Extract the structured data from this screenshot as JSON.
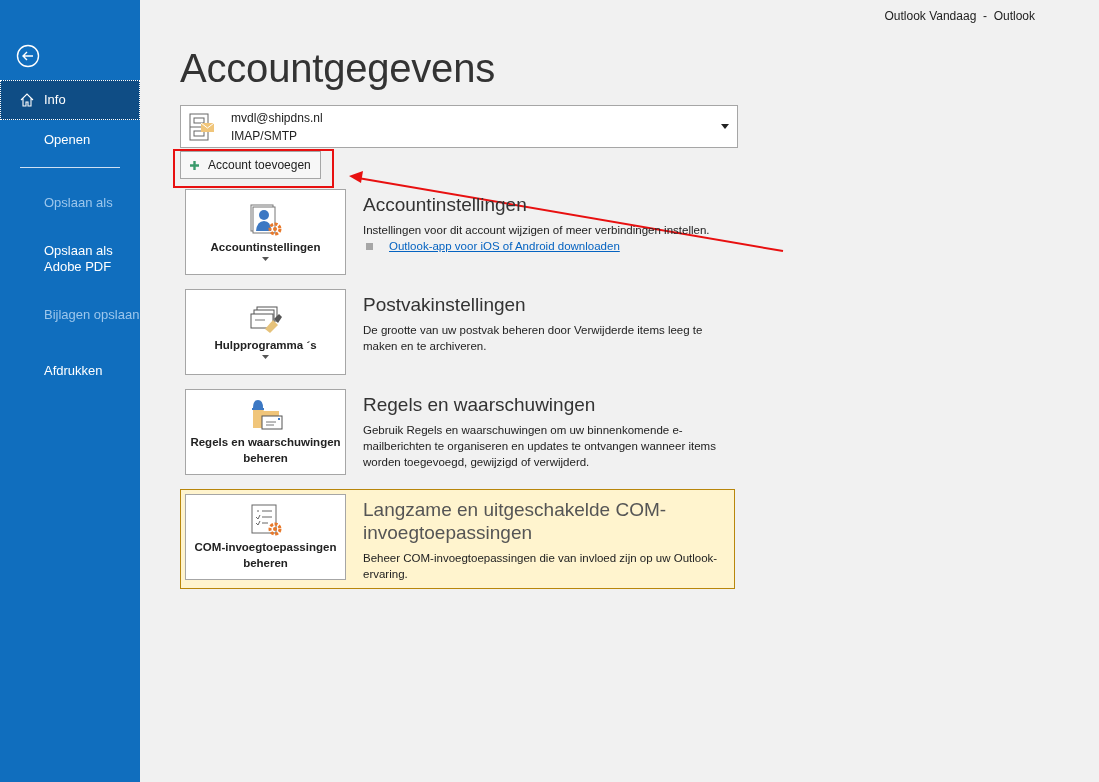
{
  "window": {
    "title": "Outlook Vandaag  -  Outlook"
  },
  "sidebar": {
    "items": [
      {
        "kind": "item",
        "label": "Info",
        "selected": true,
        "disabled": false
      },
      {
        "kind": "item",
        "label": "Openen",
        "selected": false,
        "disabled": false
      },
      {
        "kind": "separator"
      },
      {
        "kind": "item",
        "label": "Opslaan als",
        "selected": false,
        "disabled": true
      },
      {
        "kind": "item",
        "label": "Opslaan als Adobe PDF",
        "selected": false,
        "disabled": false
      },
      {
        "kind": "item",
        "label": "Bijlagen opslaan",
        "selected": false,
        "disabled": true
      },
      {
        "kind": "item",
        "label": "Afdrukken",
        "selected": false,
        "disabled": false
      }
    ]
  },
  "heading": "Accountgegevens",
  "account": {
    "email": "mvdl@shipdns.nl",
    "type": "IMAP/SMTP"
  },
  "add_account_button": "Account toevoegen",
  "sections": [
    {
      "button": "Accountinstellingen",
      "dropdown": true,
      "title": "Accountinstellingen",
      "description": "Instellingen voor dit account wijzigen of meer verbindingen instellen.",
      "link": "Outlook-app voor iOS of Android downloaden",
      "highlighted": false
    },
    {
      "button": "Hulpprogramma ´s",
      "dropdown": true,
      "title": "Postvakinstellingen",
      "description": "De grootte van uw postvak beheren door Verwijderde items leeg te maken en te archiveren.",
      "highlighted": false
    },
    {
      "button": "Regels en waarschuwingen beheren",
      "dropdown": false,
      "title": "Regels en waarschuwingen",
      "description": "Gebruik Regels en waarschuwingen om uw binnenkomende e-mailberichten te organiseren en updates te ontvangen wanneer items worden toegevoegd, gewijzigd of verwijderd.",
      "highlighted": false
    },
    {
      "button": "COM-invoegtoepassingen beheren",
      "dropdown": false,
      "title": "Langzame en uitgeschakelde COM-invoegtoepassingen",
      "description": "Beheer COM-invoegtoepassingen die van invloed zijn op uw Outlook-ervaring.",
      "highlighted": true
    }
  ]
}
